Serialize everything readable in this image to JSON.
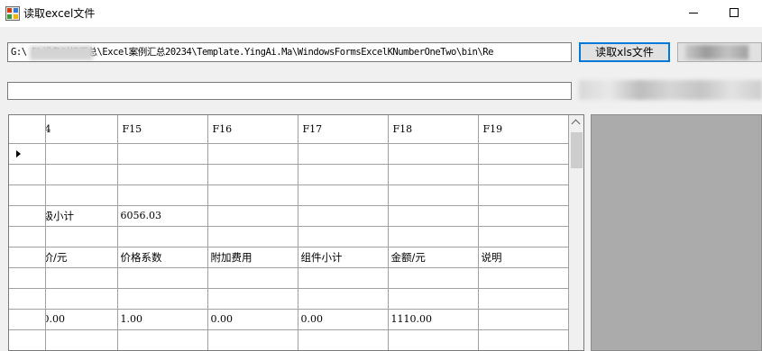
{
  "window": {
    "title": "读取excel文件"
  },
  "toolbar": {
    "path_value": "G:\\        D\\设备对接汇总\\Excel案例汇总20234\\Template.YingAi.Ma\\WindowsFormsExcelKNumberOneTwo\\bin\\Re",
    "read_button_label": "读取xls文件",
    "status_value": ""
  },
  "grid": {
    "columns": [
      "4",
      "F15",
      "F16",
      "F17",
      "F18",
      "F19"
    ],
    "rows": [
      [
        "",
        "",
        "",
        "",
        "",
        ""
      ],
      [
        "",
        "",
        "",
        "",
        "",
        ""
      ],
      [
        "",
        "",
        "",
        "",
        "",
        ""
      ],
      [
        "级小计",
        "6056.03",
        "",
        "",
        "",
        ""
      ],
      [
        "",
        "",
        "",
        "",
        "",
        ""
      ],
      [
        "价/元",
        "价格系数",
        "附加费用",
        "组件小计",
        "金额/元",
        "说明"
      ],
      [
        "",
        "",
        "",
        "",
        "",
        ""
      ],
      [
        "",
        "",
        "",
        "",
        "",
        ""
      ],
      [
        "0.00",
        "1.00",
        "0.00",
        "0.00",
        "1110.00",
        ""
      ],
      [
        "",
        "",
        "",
        "",
        "",
        ""
      ]
    ]
  }
}
